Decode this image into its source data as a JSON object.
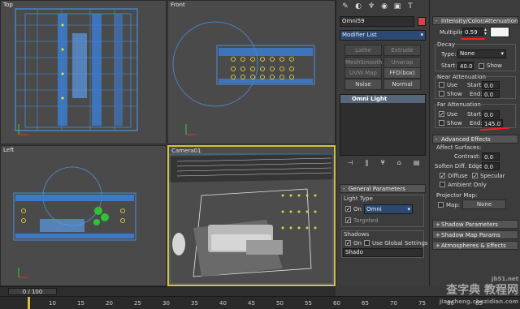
{
  "viewports": {
    "top": {
      "label": "Top"
    },
    "front": {
      "label": "Front"
    },
    "left": {
      "label": "Left"
    },
    "camera": {
      "label": "Camera01"
    }
  },
  "command_panel": {
    "object_name": "Omni59",
    "object_color": "#d44646",
    "modifier_list": "Modifier List",
    "modifier_buttons": [
      "Lathe",
      "Extrude",
      "MeshSmooth",
      "Unwrap UVW",
      "UVW Map",
      "FFD(box)",
      "Noise",
      "Normal"
    ],
    "stack_item": "Omni Light",
    "general_parameters": {
      "title": "General Parameters",
      "light_type_label": "Light Type",
      "on_label": "On",
      "type_value": "Omni",
      "targeted_label": "Targeted",
      "shadows_label": "Shadows",
      "use_global_label": "Use Global Settings",
      "shadow_type": "Shado"
    },
    "intensity": {
      "title": "Intensity/Color/Attenuation",
      "multiplier_label": "Multiplier:",
      "multiplier_value": "0.59",
      "color_swatch": "#f4f4f4",
      "decay_label": "Decay",
      "type_label": "Type:",
      "type_value": "None",
      "start_label": "Start:",
      "start_value": "40.0",
      "show_label": "Show",
      "near_label": "Near Attenuation",
      "near_use": "Use",
      "near_start_label": "Start:",
      "near_start_value": "0.0",
      "near_show": "Show",
      "near_end_label": "End:",
      "near_end_value": "0.0",
      "far_label": "Far Attenuation",
      "far_use": "Use",
      "far_start_label": "Start:",
      "far_start_value": "0.0",
      "far_show": "Show",
      "far_end_label": "End:",
      "far_end_value": "145.0"
    },
    "advanced": {
      "title": "Advanced Effects",
      "affect_surfaces": "Affect Surfaces:",
      "contrast_label": "Contrast:",
      "contrast_value": "0.0",
      "soften_label": "Soften Diff. Edge:",
      "soften_value": "0.0",
      "diffuse_label": "Diffuse",
      "specular_label": "Specular",
      "ambient_label": "Ambient Only",
      "projector_label": "Projector Map:",
      "map_label": "Map:",
      "map_value": "None"
    },
    "rollouts": [
      "Shadow Parameters",
      "Shadow Map Params",
      "Atmospheres & Effects"
    ]
  },
  "timeline": {
    "frame_counter": "0 / 100",
    "ticks": [
      "10",
      "15",
      "20",
      "25",
      "30",
      "35",
      "40",
      "45",
      "50",
      "55",
      "60",
      "65",
      "70",
      "75",
      "80",
      "85"
    ]
  },
  "watermark": {
    "site": "jb51.net",
    "main": "查字典 教程网",
    "url": "jiaocheng.chazidian.com"
  },
  "colors": {
    "wire_blue": "#4a8fe0",
    "selection_yellow": "#f2e23a",
    "annotation_red": "#ff1d1d",
    "active_border": "#d8c03a"
  }
}
